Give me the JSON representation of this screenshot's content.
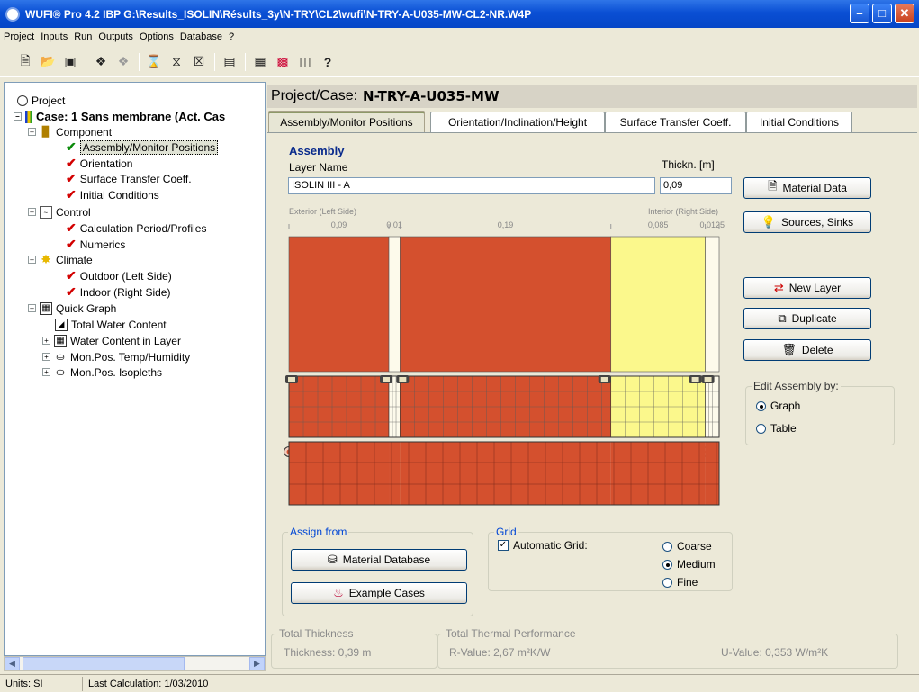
{
  "window": {
    "title": "WUFI® Pro 4.2 IBP     G:\\Results_ISOLIN\\Résults_3y\\N-TRY\\CL2\\wufi\\N-TRY-A-U035-MW-CL2-NR.W4P"
  },
  "menu": [
    "Project",
    "Inputs",
    "Run",
    "Outputs",
    "Options",
    "Database",
    "?"
  ],
  "toolbar_icons": [
    "new-file-icon",
    "open-folder-icon",
    "save-icon",
    "tree-icon",
    "tree-disabled-icon",
    "hourglass-icon",
    "hourglass-multi-icon",
    "hourglass-x-icon",
    "window-icon",
    "table-icon",
    "grid-color-icon",
    "film-icon",
    "help-icon"
  ],
  "toolbar_help": "?",
  "tree": {
    "root": "Project",
    "case": "Case: 1 Sans membrane (Act. Cas",
    "component": "Component",
    "assembly": "Assembly/Monitor Positions",
    "orientation": "Orientation",
    "surface": "Surface Transfer Coeff.",
    "initial": "Initial Conditions",
    "control": "Control",
    "calc_period": "Calculation Period/Profiles",
    "numerics": "Numerics",
    "climate": "Climate",
    "outdoor": "Outdoor (Left Side)",
    "indoor": "Indoor (Right Side)",
    "quick_graph": "Quick Graph",
    "total_water": "Total Water Content",
    "water_layer": "Water Content in Layer",
    "mon_temp": "Mon.Pos. Temp/Humidity",
    "mon_iso": "Mon.Pos. Isopleths"
  },
  "status": {
    "units": "Units: SI",
    "last_calc": "Last Calculation: 1/03/2010"
  },
  "header": {
    "prefix": "Project/Case:",
    "case_name": "N-TRY-A-U035-MW"
  },
  "tabs": [
    "Assembly/Monitor Positions",
    "Orientation/Inclination/Height",
    "Surface Transfer Coeff.",
    "Initial Conditions"
  ],
  "assembly": {
    "title": "Assembly",
    "layer_name_label": "Layer Name",
    "thickness_label": "Thickn. [m]",
    "layer_name_value": "ISOLIN III - A",
    "thickness_value": "0,09",
    "exterior_label": "Exterior (Left Side)",
    "interior_label": "Interior (Right Side)",
    "dims": [
      "0,09",
      "0,01",
      "0,19",
      "0,085",
      "0,0125"
    ]
  },
  "layers": [
    {
      "thickness_m": 0.09,
      "color": "#d4502e"
    },
    {
      "thickness_m": 0.01,
      "color": "#fdfaeb"
    },
    {
      "thickness_m": 0.19,
      "color": "#d4502e"
    },
    {
      "thickness_m": 0.085,
      "color": "#fbf88c"
    },
    {
      "thickness_m": 0.0125,
      "color": "#fdfaeb"
    }
  ],
  "buttons": {
    "material_data": "Material Data",
    "sources_sinks": "Sources, Sinks",
    "new_layer": "New Layer",
    "duplicate": "Duplicate",
    "delete": "Delete",
    "material_database": "Material Database",
    "example_cases": "Example Cases"
  },
  "edit_by": {
    "legend": "Edit Assembly by:",
    "graph": "Graph",
    "table": "Table",
    "selected": "Graph"
  },
  "assign_from": {
    "legend": "Assign from"
  },
  "grid": {
    "legend": "Grid",
    "automatic": "Automatic Grid:",
    "automatic_checked": true,
    "coarse": "Coarse",
    "medium": "Medium",
    "fine": "Fine",
    "selected": "Medium"
  },
  "totals": {
    "thickness_legend": "Total Thickness",
    "thickness": "Thickness: 0,39 m",
    "thermal_legend": "Total Thermal Performance",
    "r_value": "R-Value: 2,67 m²K/W",
    "u_value": "U-Value: 0,353 W/m²K"
  }
}
